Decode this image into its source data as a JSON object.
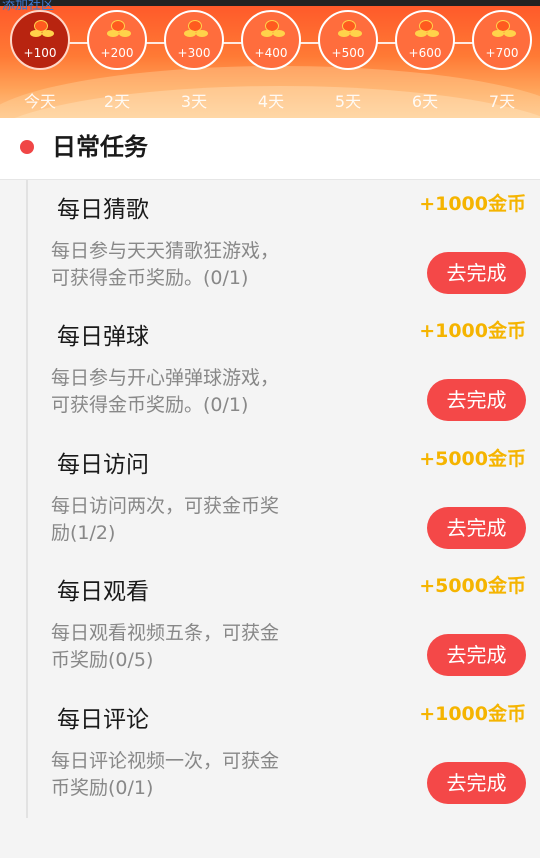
{
  "corner_link": "添加社区",
  "checkin": {
    "days": [
      {
        "amount": "+100",
        "label": "今天",
        "active": true
      },
      {
        "amount": "+200",
        "label": "2天"
      },
      {
        "amount": "+300",
        "label": "3天"
      },
      {
        "amount": "+400",
        "label": "4天"
      },
      {
        "amount": "+500",
        "label": "5天"
      },
      {
        "amount": "+600",
        "label": "6天"
      },
      {
        "amount": "+700",
        "label": "7天"
      }
    ]
  },
  "section": {
    "title": "日常任务"
  },
  "tasks": [
    {
      "name": "每日猜歌",
      "reward": "+1000金币",
      "desc": " 每日参与天天猜歌狂游戏，\n可获得金币奖励。(0/1)",
      "button": "去完成"
    },
    {
      "name": "每日弹球",
      "reward": "+1000金币",
      "desc": " 每日参与开心弹弹球游戏，\n可获得金币奖励。(0/1)",
      "button": "去完成"
    },
    {
      "name": "每日访问",
      "reward": "+5000金币",
      "desc": " 每日访问两次，可获金币奖\n励(1/2)",
      "button": "去完成"
    },
    {
      "name": "每日观看",
      "reward": "+5000金币",
      "desc": " 每日观看视频五条，可获金\n币奖励(0/5)",
      "button": "去完成"
    },
    {
      "name": "每日评论",
      "reward": "+1000金币",
      "desc": " 每日评论视频一次，可获金\n币奖励(0/1)",
      "button": "去完成"
    }
  ],
  "colors": {
    "accent": "#f44848",
    "reward": "#f5b400",
    "header_top": "#ff5a2a"
  }
}
